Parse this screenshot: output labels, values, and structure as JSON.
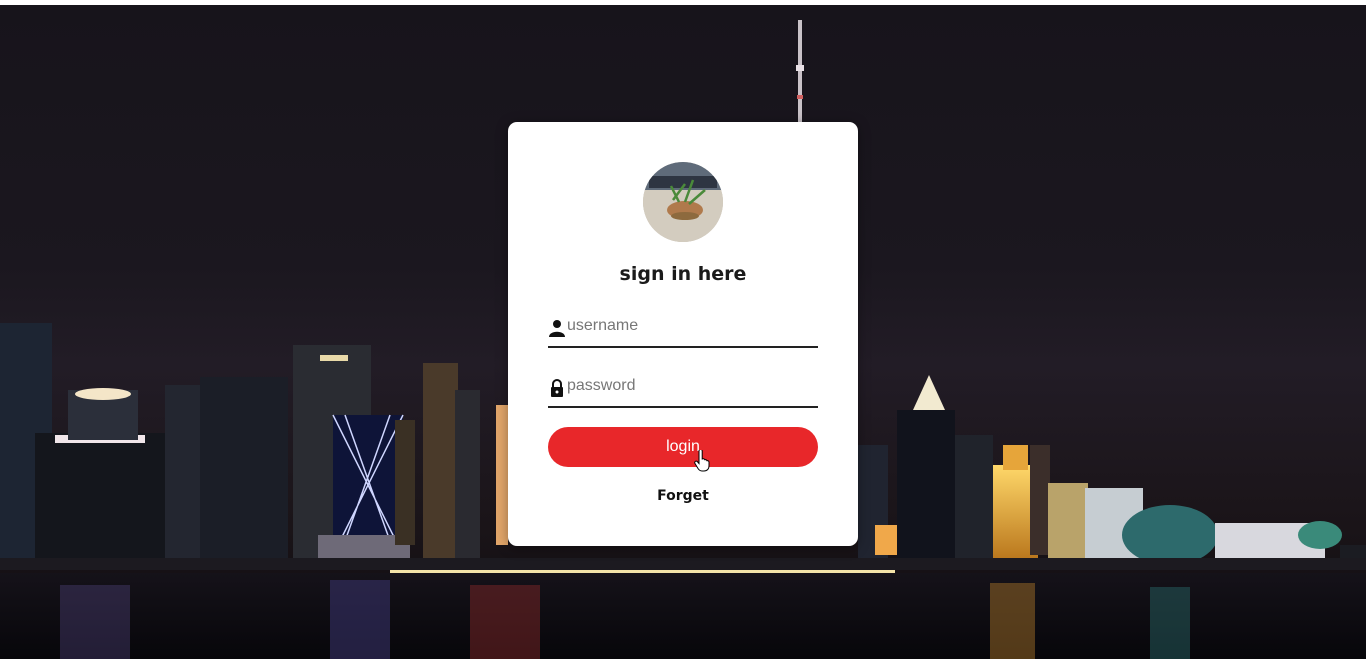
{
  "background": {
    "description_icon": "city-skyline-night-photo"
  },
  "login_card": {
    "avatar_icon": "avatar-photo",
    "title": "sign in here",
    "username": {
      "icon": "user-icon",
      "placeholder": "username",
      "value": ""
    },
    "password": {
      "icon": "lock-icon",
      "placeholder": "password",
      "value": ""
    },
    "login_label": "login",
    "forget_label": "Forget"
  },
  "colors": {
    "accent": "#e8272a",
    "card": "#ffffff",
    "text": "#1b1b1b"
  }
}
